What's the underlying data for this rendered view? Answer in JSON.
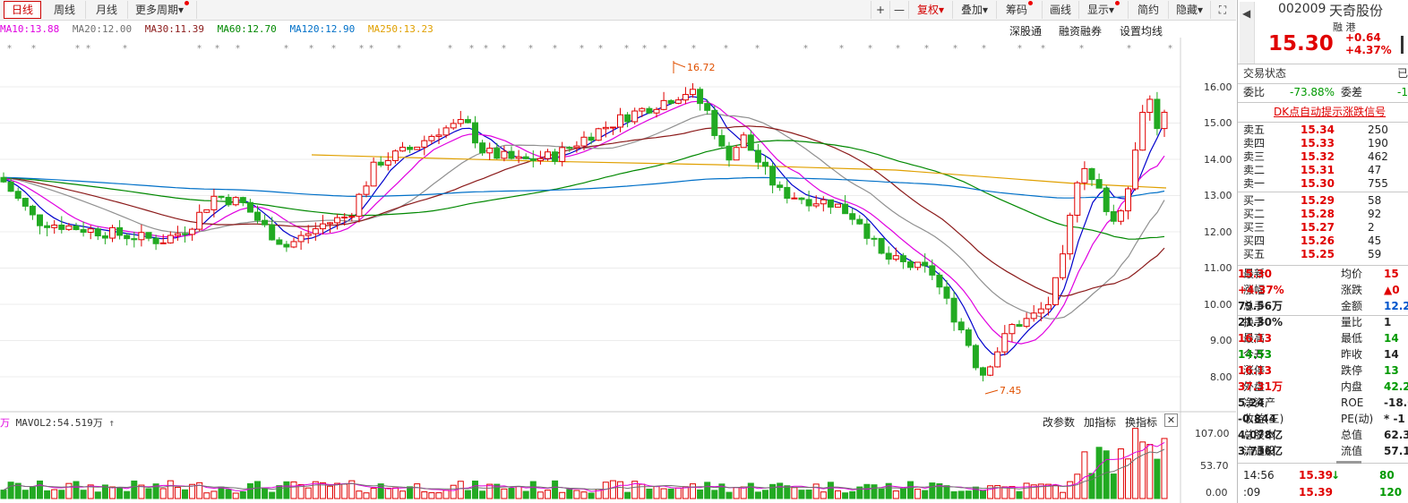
{
  "toolbar": {
    "tabs": [
      "日线",
      "周线",
      "月线",
      "更多周期"
    ],
    "buttons": [
      "+",
      "—",
      "复权",
      "叠加",
      "筹码",
      "画线",
      "显示",
      "简约",
      "隐藏"
    ]
  },
  "ma_legend": [
    {
      "label": "MA10:13.88",
      "color": "#e000e0"
    },
    {
      "label": "MA20:12.00",
      "color": "#707070"
    },
    {
      "label": "MA30:11.39",
      "color": "#8b1a1a"
    },
    {
      "label": "MA60:12.70",
      "color": "#008800"
    },
    {
      "label": "MA120:12.90",
      "color": "#0070c8"
    },
    {
      "label": "MA250:13.23",
      "color": "#e0a000"
    }
  ],
  "chart_links": [
    "深股通",
    "融资融券",
    "设置均线"
  ],
  "price_axis": [
    "16.00",
    "15.00",
    "14.00",
    "13.00",
    "12.00",
    "11.00",
    "10.00",
    "9.00",
    "8.00"
  ],
  "annotations": {
    "high": "16.72",
    "low": "7.45"
  },
  "vol_header": {
    "label": "MAVOL2:54.519万",
    "links": [
      "改参数",
      "加指标",
      "换指标"
    ]
  },
  "vol_axis": [
    "107.00",
    "53.70",
    "0.00"
  ],
  "quote": {
    "code": "002009",
    "name": "天奇股份",
    "tags": "融 港",
    "price": "15.30",
    "change": "+0.64",
    "pct": "+4.37%"
  },
  "status": {
    "label": "交易状态",
    "value": "已"
  },
  "weibi": {
    "label1": "委比",
    "val1": "-73.88%",
    "label2": "委差",
    "val2": "-1"
  },
  "dk_signal": "DK点自动提示涨跌信号",
  "sells": [
    {
      "label": "卖五",
      "price": "15.34",
      "vol": "250"
    },
    {
      "label": "卖四",
      "price": "15.33",
      "vol": "190"
    },
    {
      "label": "卖三",
      "price": "15.32",
      "vol": "462"
    },
    {
      "label": "卖二",
      "price": "15.31",
      "vol": "47"
    },
    {
      "label": "卖一",
      "price": "15.30",
      "vol": "755"
    }
  ],
  "buys": [
    {
      "label": "买一",
      "price": "15.29",
      "vol": "58"
    },
    {
      "label": "买二",
      "price": "15.28",
      "vol": "92"
    },
    {
      "label": "买三",
      "price": "15.27",
      "vol": "2"
    },
    {
      "label": "买四",
      "price": "15.26",
      "vol": "45"
    },
    {
      "label": "买五",
      "price": "15.25",
      "vol": "59"
    }
  ],
  "stats": [
    {
      "l1": "最新",
      "v1": "15.30",
      "c1": "red",
      "l2": "均价",
      "v2": "15",
      "c2": "red"
    },
    {
      "l1": "涨幅",
      "v1": "+4.37%",
      "c1": "red",
      "l2": "涨跌",
      "v2": "▲0",
      "c2": "red"
    },
    {
      "l1": "总手",
      "v1": "79.56万",
      "c1": "",
      "l2": "金额",
      "v2": "12.2",
      "c2": "blue"
    },
    {
      "l1": "换手",
      "v1": "21.30%",
      "c1": "",
      "l2": "量比",
      "v2": "1",
      "c2": ""
    },
    {
      "l1": "最高",
      "v1": "16.13",
      "c1": "red",
      "l2": "最低",
      "v2": "14",
      "c2": "green"
    },
    {
      "l1": "今开",
      "v1": "14.53",
      "c1": "green",
      "l2": "昨收",
      "v2": "14",
      "c2": ""
    },
    {
      "l1": "涨停",
      "v1": "16.13",
      "c1": "red",
      "l2": "跌停",
      "v2": "13",
      "c2": "green"
    },
    {
      "l1": "外盘",
      "v1": "37.31万",
      "c1": "red",
      "l2": "内盘",
      "v2": "42.2",
      "c2": "green"
    },
    {
      "l1": "净资产",
      "v1": "5.24",
      "c1": "",
      "l2": "ROE",
      "v2": "-18.0",
      "c2": ""
    },
    {
      "l1": "收益(三)",
      "v1": "-0.844",
      "c1": "",
      "l2": "PE(动)",
      "v2": "* -1",
      "c2": ""
    },
    {
      "l1": "总股本",
      "v1": "4.078亿",
      "c1": "",
      "l2": "总值",
      "v2": "62.3",
      "c2": ""
    },
    {
      "l1": "流通股",
      "v1": "3.736亿",
      "c1": "",
      "l2": "流值",
      "v2": "57.1",
      "c2": ""
    }
  ],
  "ticks": [
    {
      "time": "14:56",
      "price": "15.39",
      "arrow": "↓",
      "vol": "80"
    },
    {
      "time": ":09",
      "price": "15.39",
      "arrow": "",
      "vol": "120"
    }
  ],
  "chart_data": {
    "type": "candlestick",
    "ylim": [
      7.45,
      16.72
    ],
    "yticks": [
      8,
      9,
      10,
      11,
      12,
      13,
      14,
      15,
      16
    ],
    "ma_lines": [
      "MA10",
      "MA20",
      "MA30",
      "MA60",
      "MA120",
      "MA250"
    ]
  }
}
